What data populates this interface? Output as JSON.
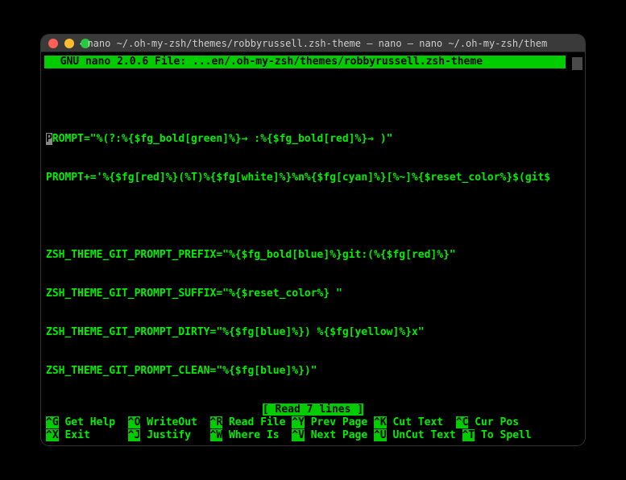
{
  "titlebar": {
    "text": "~ — nano ~/.oh-my-zsh/themes/robbyrussell.zsh-theme — nano — nano ~/.oh-my-zsh/theme..."
  },
  "header": {
    "text": "  GNU nano 2.0.6 File: ...en/.oh-my-zsh/themes/robbyrussell.zsh-theme           "
  },
  "lines": [
    "PROMPT=\"%(?:%{$fg_bold[green]%}→ :%{$fg_bold[red]%}→ )\"",
    "PROMPT+='%{$fg[red]%}(%T)%{$fg[white]%}%n%{$fg[cyan]%}[%~]%{$reset_color%}$(git$",
    "",
    "ZSH_THEME_GIT_PROMPT_PREFIX=\"%{$fg_bold[blue]%}git:(%{$fg[red]%}\"",
    "ZSH_THEME_GIT_PROMPT_SUFFIX=\"%{$reset_color%} \"",
    "ZSH_THEME_GIT_PROMPT_DIRTY=\"%{$fg[blue]%}) %{$fg[yellow]%}x\"",
    "ZSH_THEME_GIT_PROMPT_CLEAN=\"%{$fg[blue]%})\""
  ],
  "status": {
    "text": "[ Read 7 lines ]"
  },
  "shortcuts": {
    "row1": [
      {
        "key": "^G",
        "label": "Get Help "
      },
      {
        "key": "^O",
        "label": "WriteOut "
      },
      {
        "key": "^R",
        "label": "Read File"
      },
      {
        "key": "^Y",
        "label": "Prev Page"
      },
      {
        "key": "^K",
        "label": "Cut Text "
      },
      {
        "key": "^C",
        "label": "Cur Pos"
      }
    ],
    "row2": [
      {
        "key": "^X",
        "label": "Exit     "
      },
      {
        "key": "^J",
        "label": "Justify  "
      },
      {
        "key": "^W",
        "label": "Where Is "
      },
      {
        "key": "^V",
        "label": "Next Page"
      },
      {
        "key": "^U",
        "label": "UnCut Text"
      },
      {
        "key": "^T",
        "label": "To Spell"
      }
    ]
  }
}
